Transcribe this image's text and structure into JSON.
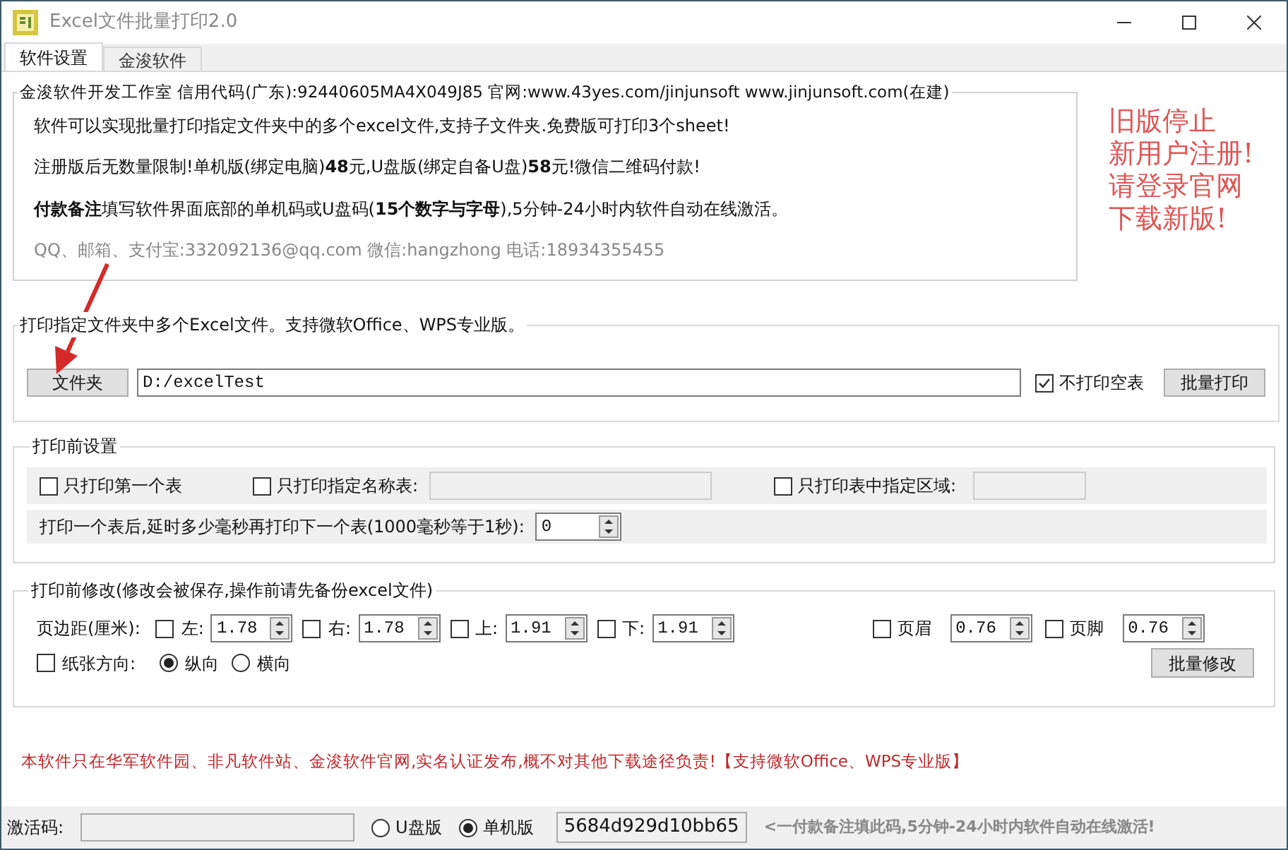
{
  "window": {
    "title": "Excel文件批量打印2.0"
  },
  "tabs": [
    {
      "label": "软件设置",
      "selected": true
    },
    {
      "label": "金浚软件",
      "selected": false
    }
  ],
  "info": {
    "title": "金浚软件开发工作室 信用代码(广东):92440605MA4X049J85 官网:www.43yes.com/jinjunsoft  www.jinjunsoft.com(在建)",
    "lines": [
      "软件可以实现批量打印指定文件夹中的多个excel文件,支持子文件夹.免费版可打印3个sheet!",
      "注册版后无数量限制!单机版(绑定电脑)**48**元,U盘版(绑定自备U盘)**58**元!微信二维码付款!",
      "**付款备注**填写软件界面底部的单机码或U盘码(**15个数字与字母**),5分钟-24小时内软件自动在线激活。"
    ],
    "contact": "QQ、邮箱、支付宝:332092136@qq.com    微信:hangzhong    电话:18934355455"
  },
  "notice": [
    "旧版停止",
    "新用户注册!",
    "请登录官网",
    "下载新版!"
  ],
  "folder_section": {
    "title": "打印指定文件夹中多个Excel文件。支持微软Office、WPS专业版。",
    "folder_button": "文件夹",
    "path": "D:/excelTest",
    "skip_blank": {
      "label": "不打印空表",
      "checked": true
    },
    "print_button": "批量打印"
  },
  "pre_settings": {
    "title": "打印前设置",
    "first_sheet": {
      "label": "只打印第一个表",
      "checked": false
    },
    "named_sheet": {
      "label": "只打印指定名称表:",
      "checked": false
    },
    "range": {
      "label": "只打印表中指定区域:",
      "checked": false
    },
    "delay": {
      "label": "打印一个表后,延时多少毫秒再打印下一个表(1000毫秒等于1秒):",
      "value": "0"
    }
  },
  "modify": {
    "title": "打印前修改(修改会被保存,操作前请先备份excel文件)",
    "margin_label": "页边距(厘米):",
    "margins": [
      {
        "label": "左:",
        "checked": false,
        "value": "1.78"
      },
      {
        "label": "右:",
        "checked": false,
        "value": "1.78"
      },
      {
        "label": "上:",
        "checked": false,
        "value": "1.91"
      },
      {
        "label": "下:",
        "checked": false,
        "value": "1.91"
      }
    ],
    "header_footer": [
      {
        "label": "页眉",
        "checked": false,
        "value": "0.76"
      },
      {
        "label": "页脚",
        "checked": false,
        "value": "0.76"
      }
    ],
    "orientation": {
      "label": "纸张方向:",
      "checked": false,
      "options": [
        {
          "label": "纵向",
          "selected": true
        },
        {
          "label": "横向",
          "selected": false
        }
      ]
    },
    "apply_button": "批量修改"
  },
  "disclaimer": "本软件只在华军软件园、非凡软件站、金浚软件官网,实名认证发布,概不对其他下载途径负责!【支持微软Office、WPS专业版】",
  "activation": {
    "label": "激活码:",
    "editions": [
      {
        "label": "U盘版",
        "selected": false
      },
      {
        "label": "单机版",
        "selected": true
      }
    ],
    "code": "5684d929d10bb65",
    "hint": "<一付款备注填此码,5分钟-24小时内软件自动在线激活!"
  }
}
